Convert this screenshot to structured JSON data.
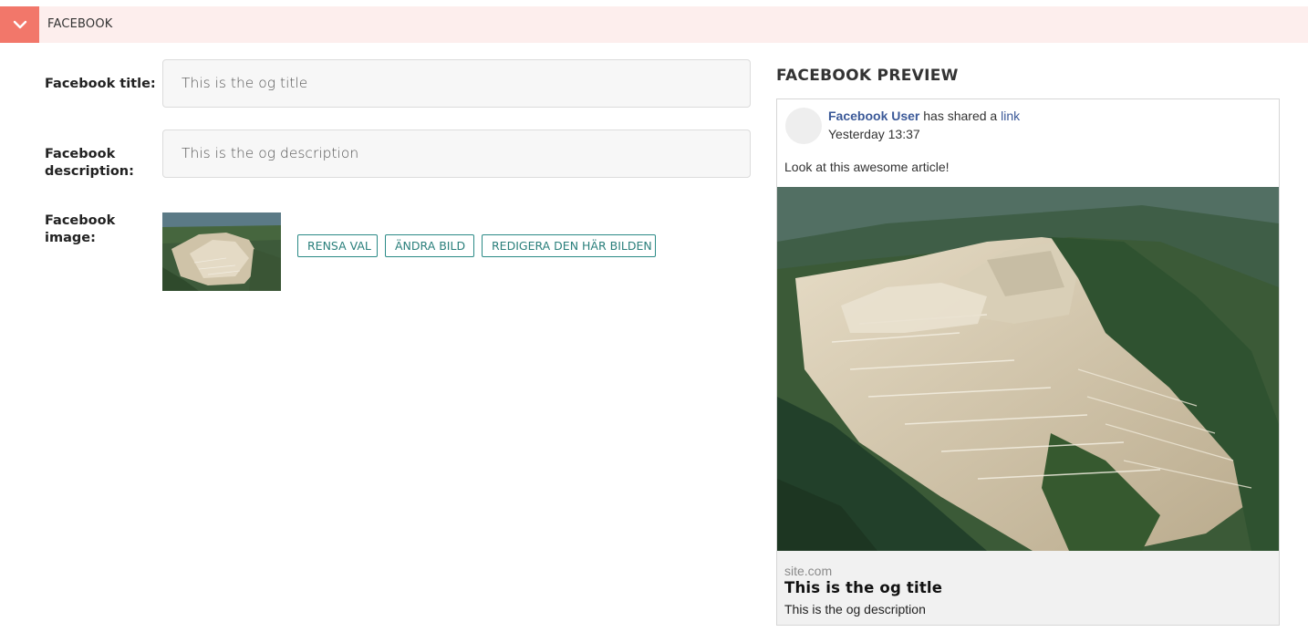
{
  "section": {
    "title": "FACEBOOK",
    "toggle_icon": "chevron-down-icon",
    "accent_color": "#f2776a",
    "header_bg": "#fdeeed"
  },
  "form": {
    "title_label": "Facebook title:",
    "title_value": "This is the og title",
    "description_label_line1": "Facebook",
    "description_label_line2": "description:",
    "description_value": "This is the og description",
    "image_label_line1": "Facebook",
    "image_label_line2": "image:",
    "buttons": {
      "clear": "RENSA VAL",
      "change": "ÄNDRA BILD",
      "edit": "REDIGERA DEN HÄR BILDEN"
    },
    "button_color": "#2a7f7b"
  },
  "preview": {
    "heading": "FACEBOOK PREVIEW",
    "user": "Facebook User",
    "shared_text": "has shared a",
    "link_text": "link",
    "time": "Yesterday 13:37",
    "message": "Look at this awesome article!",
    "site": "site.com",
    "og_title": "This is the og title",
    "og_description": "This is the og description",
    "link_color": "#3b5998"
  }
}
